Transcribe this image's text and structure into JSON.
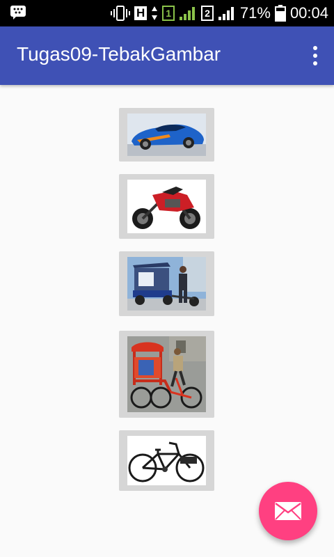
{
  "status_bar": {
    "battery_percent": "71%",
    "time": "00:04",
    "network_type": "H",
    "sim1_label": "1",
    "sim2_label": "2"
  },
  "app_bar": {
    "title": "Tugas09-TebakGambar"
  },
  "image_buttons": [
    {
      "subject": "blue sports car"
    },
    {
      "subject": "red sport motorcycle"
    },
    {
      "subject": "blue motorized rickshaw"
    },
    {
      "subject": "red cycle rickshaw"
    },
    {
      "subject": "black bicycle"
    }
  ],
  "fab": {
    "icon": "email-icon"
  },
  "colors": {
    "app_bar": "#3f51b5",
    "fab": "#ff4081",
    "background": "#fafafa"
  }
}
